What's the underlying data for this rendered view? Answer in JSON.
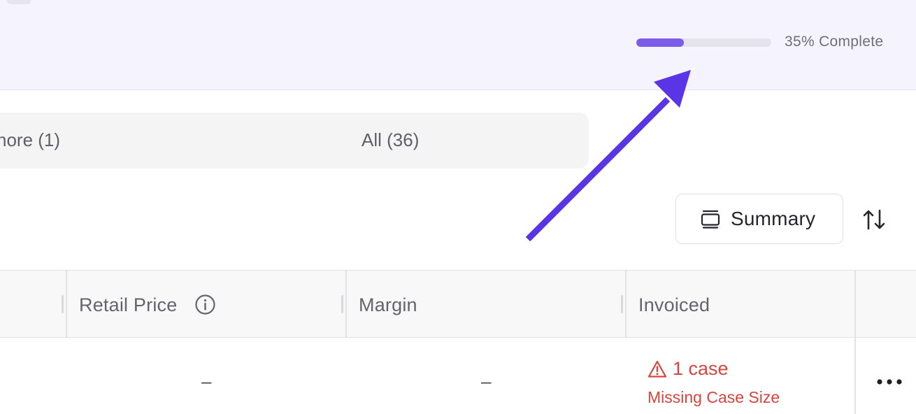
{
  "progress": {
    "value": 0.35,
    "label": "35% Complete",
    "fill_color": "#7c5ce8",
    "track_color": "#e5e3ec"
  },
  "filters": {
    "tabs": [
      {
        "label": "nore (1)"
      },
      {
        "label": "All (36)"
      }
    ]
  },
  "toolbar": {
    "summary_label": "Summary",
    "summary_icon": "summary-view-icon",
    "sort_icon": "sort-arrows-icon"
  },
  "table": {
    "columns": [
      {
        "label": "Retail Price",
        "icon": "info-icon"
      },
      {
        "label": "Margin"
      },
      {
        "label": "Invoiced"
      }
    ],
    "rows": [
      {
        "retail_price": "–",
        "margin": "–",
        "invoiced": {
          "count": "1 case",
          "detail": "Missing Case Size",
          "icon": "warning-icon"
        },
        "menu_icon": "more-horizontal-icon"
      }
    ]
  },
  "colors": {
    "accent": "#7c5ce8",
    "annotation_arrow": "#5a35e6",
    "warning": "#d9453e"
  }
}
